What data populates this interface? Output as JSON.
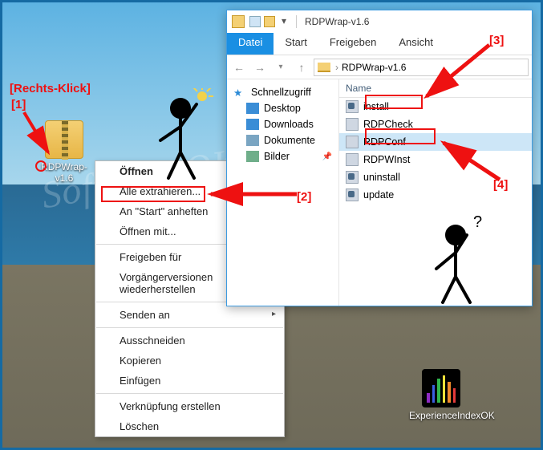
{
  "desktop": {
    "zip_icon_label": "RDPWrap-v1.6",
    "exp_icon_label": "ExperienceIndexOK",
    "exp_bars": [
      "#8e2ac3",
      "#3a5fe0",
      "#2fb64d",
      "#f2e23a",
      "#f08a2a",
      "#e33a3a"
    ]
  },
  "context_menu": {
    "open": "Öffnen",
    "extract_all": "Alle extrahieren...",
    "pin_start": "An \"Start\" anheften",
    "open_with": "Öffnen mit...",
    "share_for": "Freigeben für",
    "prev_versions": "Vorgängerversionen wiederherstellen",
    "send_to": "Senden an",
    "cut": "Ausschneiden",
    "copy": "Kopieren",
    "paste": "Einfügen",
    "link": "Verknüpfung erstellen",
    "delete": "Löschen"
  },
  "explorer": {
    "window_title": "RDPWrap-v1.6",
    "ribbon": {
      "file": "Datei",
      "start": "Start",
      "share": "Freigeben",
      "view": "Ansicht"
    },
    "breadcrumb": "RDPWrap-v1.6",
    "navpane": {
      "quick": "Schnellzugriff",
      "desktop": "Desktop",
      "downloads": "Downloads",
      "documents": "Dokumente",
      "pictures": "Bilder"
    },
    "filelist": {
      "header_name": "Name",
      "items": [
        {
          "name": "install",
          "type": "bat"
        },
        {
          "name": "RDPCheck",
          "type": "exe"
        },
        {
          "name": "RDPConf",
          "type": "exe"
        },
        {
          "name": "RDPWInst",
          "type": "exe"
        },
        {
          "name": "uninstall",
          "type": "bat"
        },
        {
          "name": "update",
          "type": "bat"
        }
      ]
    }
  },
  "annotations": {
    "right_click": "[Rechts-Klick]",
    "a1": "[1]",
    "a2": "[2]",
    "a3": "[3]",
    "a4": "[4]"
  },
  "watermark": "SoftWareOK.de"
}
